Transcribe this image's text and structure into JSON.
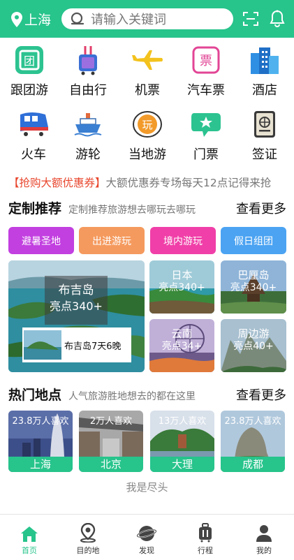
{
  "header": {
    "location": "上海",
    "search_placeholder": "请输入关键词",
    "scan_icon": "scan-icon",
    "notify_icon": "bell-icon"
  },
  "categories": [
    {
      "label": "跟团游",
      "icon": "group-tour-icon"
    },
    {
      "label": "自由行",
      "icon": "luggage-icon"
    },
    {
      "label": "机票",
      "icon": "airplane-icon"
    },
    {
      "label": "汽车票",
      "icon": "bus-ticket-icon"
    },
    {
      "label": "酒店",
      "icon": "hotel-icon"
    },
    {
      "label": "火车",
      "icon": "train-icon"
    },
    {
      "label": "游轮",
      "icon": "cruise-ship-icon"
    },
    {
      "label": "当地游",
      "icon": "local-tour-icon"
    },
    {
      "label": "门票",
      "icon": "ticket-icon"
    },
    {
      "label": "签证",
      "icon": "passport-icon"
    }
  ],
  "coupon": {
    "title": "【抢购大额优惠券】",
    "text": "大额优惠券专场每天12点记得来抢"
  },
  "custom": {
    "title": "定制推荐",
    "subtitle": "定制推荐旅游想去哪玩去哪玩",
    "more": "查看更多",
    "tags": [
      "避暑圣地",
      "出进游玩",
      "境内游玩",
      "假日组团"
    ],
    "tag_colors": [
      "#c23fe0",
      "#f59a5e",
      "#f03fa8",
      "#4ba3f2"
    ],
    "featured": {
      "name": "布吉岛",
      "points": "亮点340+",
      "caption": "布吉岛7天6晚"
    },
    "cards": [
      {
        "name": "日本",
        "points": "亮点340+"
      },
      {
        "name": "巴厘岛",
        "points": "亮点340+"
      },
      {
        "name": "云南",
        "points": "亮点34+"
      },
      {
        "name": "周边游",
        "points": "亮点40+"
      }
    ]
  },
  "hot": {
    "title": "热门地点",
    "subtitle": "人气旅游胜地想去的都在这里",
    "more": "查看更多",
    "places": [
      {
        "city": "上海",
        "likes": "23.8万人喜欢"
      },
      {
        "city": "北京",
        "likes": "2万人喜欢"
      },
      {
        "city": "大理",
        "likes": "13万人喜欢"
      },
      {
        "city": "成都",
        "likes": "23.8万人喜欢"
      }
    ]
  },
  "footer_text": "我是尽头",
  "tabs": [
    {
      "label": "首页",
      "icon": "home-icon"
    },
    {
      "label": "目的地",
      "icon": "destination-icon"
    },
    {
      "label": "发现",
      "icon": "discover-icon"
    },
    {
      "label": "行程",
      "icon": "itinerary-icon"
    },
    {
      "label": "我的",
      "icon": "profile-icon"
    }
  ],
  "colors": {
    "primary": "#27c48c",
    "coupon_red": "#e8452c"
  }
}
